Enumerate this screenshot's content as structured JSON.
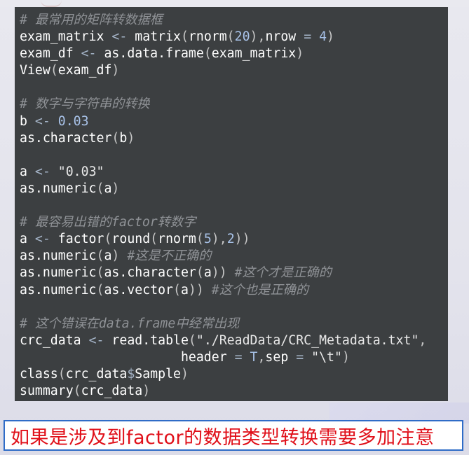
{
  "editor": {
    "lines": [
      [
        {
          "t": "# 最常用的矩阵转数据框",
          "c": "cm"
        }
      ],
      [
        {
          "t": "exam_matrix "
        },
        {
          "t": "<-",
          "c": "op"
        },
        {
          "t": " matrix"
        },
        {
          "t": "(",
          "c": "pn"
        },
        {
          "t": "rnorm"
        },
        {
          "t": "(",
          "c": "pn"
        },
        {
          "t": "20",
          "c": "num"
        },
        {
          "t": "),",
          "c": "pn"
        },
        {
          "t": "nrow "
        },
        {
          "t": "=",
          "c": "op"
        },
        {
          "t": " "
        },
        {
          "t": "4",
          "c": "num"
        },
        {
          "t": ")",
          "c": "pn"
        }
      ],
      [
        {
          "t": "exam_df "
        },
        {
          "t": "<-",
          "c": "op"
        },
        {
          "t": " as.data.frame"
        },
        {
          "t": "(",
          "c": "pn"
        },
        {
          "t": "exam_matrix"
        },
        {
          "t": ")",
          "c": "pn"
        }
      ],
      [
        {
          "t": "View"
        },
        {
          "t": "(",
          "c": "pn"
        },
        {
          "t": "exam_df"
        },
        {
          "t": ")",
          "c": "pn"
        }
      ],
      [],
      [
        {
          "t": "# 数字与字符串的转换",
          "c": "cm"
        }
      ],
      [
        {
          "t": "b "
        },
        {
          "t": "<-",
          "c": "op"
        },
        {
          "t": " "
        },
        {
          "t": "0.03",
          "c": "num"
        }
      ],
      [
        {
          "t": "as.character"
        },
        {
          "t": "(",
          "c": "pn"
        },
        {
          "t": "b"
        },
        {
          "t": ")",
          "c": "pn"
        }
      ],
      [],
      [
        {
          "t": "a "
        },
        {
          "t": "<-",
          "c": "op"
        },
        {
          "t": " "
        },
        {
          "t": "\"0.03\"",
          "c": "str"
        }
      ],
      [
        {
          "t": "as.numeric"
        },
        {
          "t": "(",
          "c": "pn"
        },
        {
          "t": "a"
        },
        {
          "t": ")",
          "c": "pn"
        }
      ],
      [],
      [
        {
          "t": "# 最容易出错的factor转数字",
          "c": "cm"
        }
      ],
      [
        {
          "t": "a "
        },
        {
          "t": "<-",
          "c": "op"
        },
        {
          "t": " factor"
        },
        {
          "t": "(",
          "c": "pn"
        },
        {
          "t": "round"
        },
        {
          "t": "(",
          "c": "pn"
        },
        {
          "t": "rnorm"
        },
        {
          "t": "(",
          "c": "pn"
        },
        {
          "t": "5",
          "c": "num"
        },
        {
          "t": "),",
          "c": "pn"
        },
        {
          "t": "2",
          "c": "num"
        },
        {
          "t": "))",
          "c": "pn"
        }
      ],
      [
        {
          "t": "as.numeric"
        },
        {
          "t": "(",
          "c": "pn"
        },
        {
          "t": "a"
        },
        {
          "t": ")",
          "c": "pn"
        },
        {
          "t": " "
        },
        {
          "t": "#这是不正确的",
          "c": "cm"
        }
      ],
      [
        {
          "t": "as.numeric"
        },
        {
          "t": "(",
          "c": "pn"
        },
        {
          "t": "as.character"
        },
        {
          "t": "(",
          "c": "pn"
        },
        {
          "t": "a"
        },
        {
          "t": "))",
          "c": "pn"
        },
        {
          "t": " "
        },
        {
          "t": "#这个才是正确的",
          "c": "cm"
        }
      ],
      [
        {
          "t": "as.numeric"
        },
        {
          "t": "(",
          "c": "pn"
        },
        {
          "t": "as.vector"
        },
        {
          "t": "(",
          "c": "pn"
        },
        {
          "t": "a"
        },
        {
          "t": "))",
          "c": "pn"
        },
        {
          "t": " "
        },
        {
          "t": "#这个也是正确的",
          "c": "cm"
        }
      ],
      [],
      [
        {
          "t": "# 这个错误在data.frame中经常出现",
          "c": "cm"
        }
      ],
      [
        {
          "t": "crc_data "
        },
        {
          "t": "<-",
          "c": "op"
        },
        {
          "t": " read.table"
        },
        {
          "t": "(",
          "c": "pn"
        },
        {
          "t": "\"./ReadData/CRC_Metadata.txt\"",
          "c": "str"
        },
        {
          "t": ",",
          "c": "pn"
        }
      ],
      [
        {
          "t": "                     header "
        },
        {
          "t": "=",
          "c": "op"
        },
        {
          "t": " "
        },
        {
          "t": "T",
          "c": "num"
        },
        {
          "t": ",",
          "c": "pn"
        },
        {
          "t": "sep "
        },
        {
          "t": "=",
          "c": "op"
        },
        {
          "t": " "
        },
        {
          "t": "\"\\t\"",
          "c": "str"
        },
        {
          "t": ")",
          "c": "pn"
        }
      ],
      [
        {
          "t": "class"
        },
        {
          "t": "(",
          "c": "pn"
        },
        {
          "t": "crc_data"
        },
        {
          "t": "$",
          "c": "op"
        },
        {
          "t": "Sample"
        },
        {
          "t": ")",
          "c": "pn"
        }
      ],
      [
        {
          "t": "summary"
        },
        {
          "t": "(",
          "c": "pn"
        },
        {
          "t": "crc_data"
        },
        {
          "t": ")",
          "c": "pn"
        }
      ]
    ]
  },
  "caption": {
    "text": "如果是涉及到factor的数据类型转换需要多加注意"
  }
}
